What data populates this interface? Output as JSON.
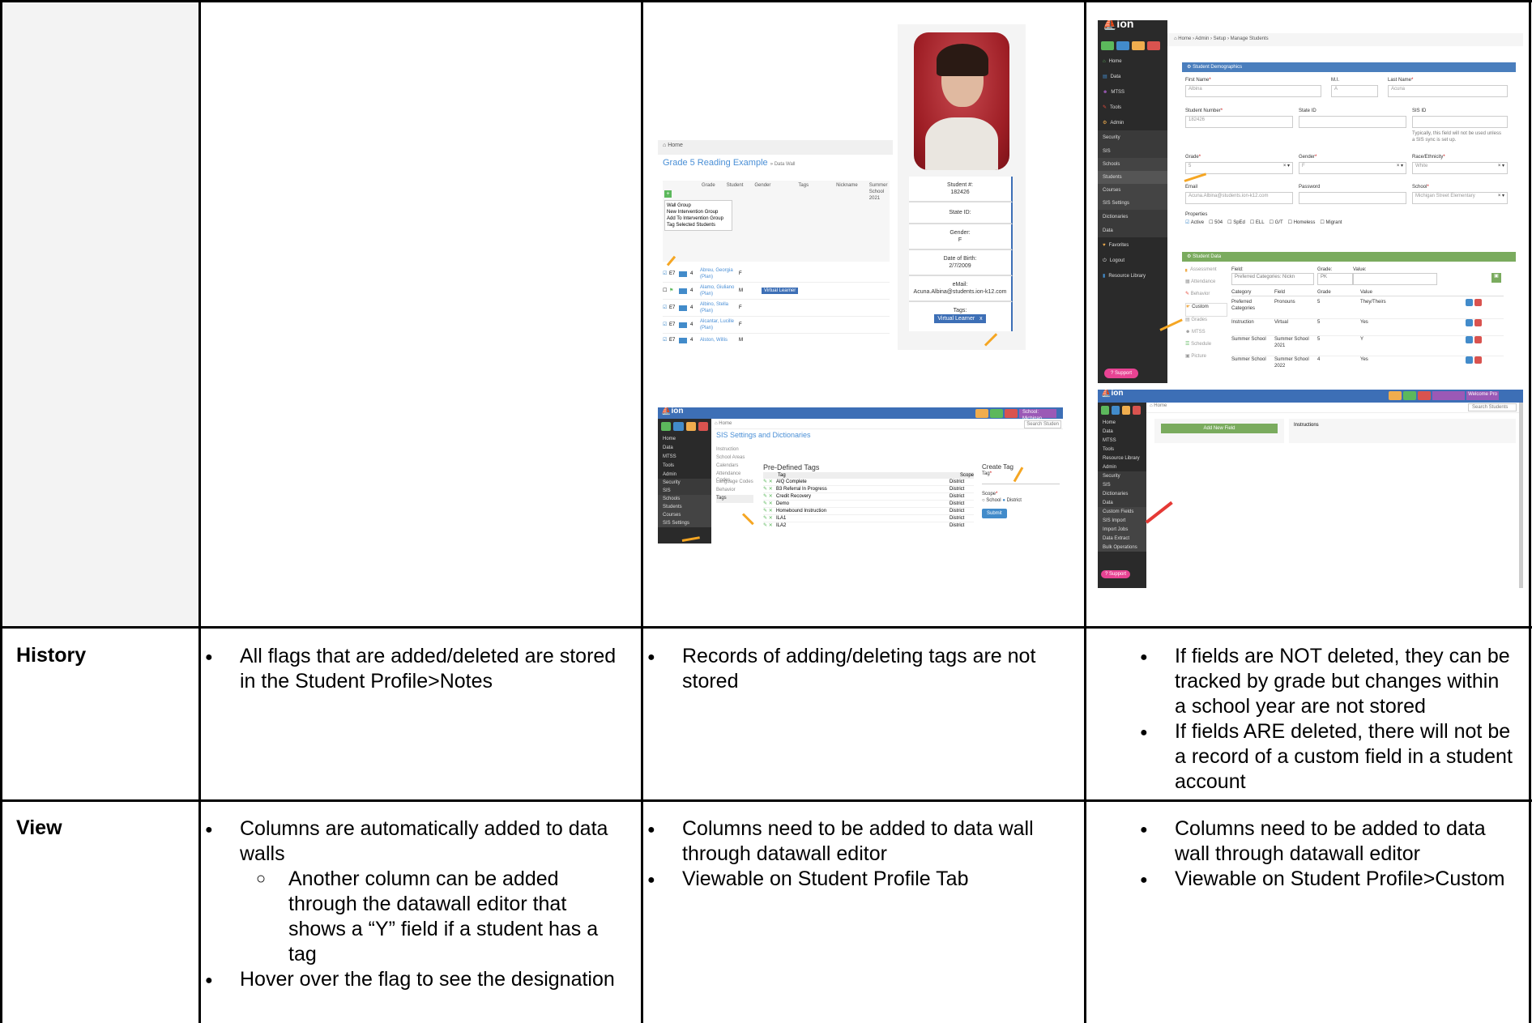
{
  "rows": {
    "history": {
      "label": "History",
      "col1": [
        "All flags that are added/deleted are stored in the Student Profile>Notes"
      ],
      "col2": [
        "Records of adding/deleting tags are not stored"
      ],
      "col3": [
        "If fields are NOT deleted, they can be tracked by grade but changes within a school year are not stored",
        "If fields ARE deleted, there will not be a record of a custom field in a student account"
      ]
    },
    "view": {
      "label": "View",
      "col1_a": "Columns are automatically added to data walls",
      "col1_sub": "Another column can be added through the datawall editor that shows a “Y” field if a student has a tag",
      "col1_b": "Hover over the flag to see the designation",
      "col2": [
        "Columns need to be added to data wall through datawall editor",
        "Viewable on Student Profile Tab"
      ],
      "col3": [
        "Columns need to be added to data wall through datawall editor",
        "Viewable on Student Profile>Custom"
      ]
    }
  },
  "shot_datawall": {
    "home": "Home",
    "title": "Grade 5 Reading Example",
    "crumb": "» Data Wall",
    "headers": [
      "Grade",
      "Student",
      "Gender",
      "Tags",
      "Nickname",
      "Summer School 2021",
      "Summ Scho 202"
    ],
    "menu": [
      "Wall Group",
      "New Intervention Group",
      "Add To Intervention Group",
      "Tag Selected Students"
    ],
    "students": [
      {
        "id": "E7",
        "grade": "4",
        "name": "Abreu, Georgia (Plan)",
        "gender": "F",
        "tag": ""
      },
      {
        "id": "",
        "grade": "4",
        "name": "Alamo, Giuliano (Plan)",
        "gender": "M",
        "tag": "Virtual Learner"
      },
      {
        "id": "E7",
        "grade": "4",
        "name": "Albino, Stella (Plan)",
        "gender": "F",
        "tag": ""
      },
      {
        "id": "E7",
        "grade": "4",
        "name": "Alcantar, Lucille (Plan)",
        "gender": "F",
        "tag": ""
      },
      {
        "id": "E7",
        "grade": "4",
        "name": "Alston, Willis",
        "gender": "M",
        "tag": ""
      }
    ]
  },
  "shot_profile": {
    "student_number_label": "Student #:",
    "student_number": "182426",
    "state_id_label": "State ID:",
    "gender_label": "Gender:",
    "gender": "F",
    "dob_label": "Date of Birth:",
    "dob": "2/7/2009",
    "email_label": "eMail:",
    "email": "Acuna.Albina@students.ion-k12.com",
    "tags_label": "Tags:",
    "tag": "Virtual Learner",
    "tag_x": "x"
  },
  "shot_sis": {
    "home": "Home",
    "title": "SIS Settings and Dictionaries",
    "search": "Search Studen",
    "school_user": "School: Michigan Street",
    "nav": [
      "Home",
      "Data",
      "MTSS",
      "Tools",
      "Admin",
      "Security",
      "SIS",
      "Schools",
      "Students",
      "Courses",
      "SIS Settings"
    ],
    "tabs": [
      "Instruction",
      "School Areas",
      "Calendars",
      "Attendance Codes",
      "Language Codes",
      "Behavior",
      "Tags"
    ],
    "table_title": "Pre-Defined Tags",
    "table_headers": [
      "Tag",
      "Scope"
    ],
    "tags": [
      {
        "name": "AIQ Complete",
        "scope": "District"
      },
      {
        "name": "B3 Referral In Progress",
        "scope": "District"
      },
      {
        "name": "Credit Recovery",
        "scope": "District"
      },
      {
        "name": "Demo",
        "scope": "District"
      },
      {
        "name": "Homebound Instruction",
        "scope": "District"
      },
      {
        "name": "ILA1",
        "scope": "District"
      },
      {
        "name": "ILA2",
        "scope": "District"
      }
    ],
    "create_title": "Create Tag",
    "tag_label": "Tag",
    "scope_label": "Scope",
    "scope_opts": [
      "School",
      "District"
    ],
    "submit": "Submit"
  },
  "shot_manage": {
    "breadcrumb": "Home › Admin › Setup › Manage Students",
    "nav": [
      "Home",
      "Data",
      "MTSS",
      "Tools",
      "Admin",
      "Security",
      "SIS",
      "Schools",
      "Students",
      "Courses",
      "SIS Settings",
      "Dictionaries",
      "Data",
      "Favorites",
      "Logout",
      "Resource Library"
    ],
    "support": "Support",
    "demo_title": "Student Demographics",
    "first_name_label": "First Name",
    "first_name": "Albina",
    "mi_label": "M.I.",
    "mi": "A",
    "last_name_label": "Last Name",
    "last_name": "Acuna",
    "student_number_label": "Student Number",
    "student_number": "182426",
    "state_id_label": "State ID",
    "sis_id_label": "SIS ID",
    "sis_note": "Typically, this field will not be used unless a SIS sync is set up.",
    "grade_label": "Grade",
    "grade": "5",
    "gender_label": "Gender",
    "gender": "F",
    "race_label": "Race/Ethnicity",
    "race": "White",
    "email_label": "Email",
    "email": "Acuna.Albina@students.ion-k12.com",
    "password_label": "Password",
    "school_label": "School",
    "school": "Michigan Street Elementary",
    "properties_label": "Properties",
    "properties": [
      "Active",
      "504",
      "SpEd",
      "ELL",
      "G/T",
      "Homeless",
      "Migrant"
    ],
    "data_title": "Student Data",
    "data_tabs": [
      "Assessment",
      "Attendance",
      "Behavior",
      "Custom",
      "Grades",
      "MTSS",
      "Schedule",
      "Picture"
    ],
    "field_label": "Field:",
    "field_value": "Preferred Categories: Nickn",
    "grade_f_label": "Grade:",
    "grade_f_value": "PK",
    "value_label": "Value:",
    "table_headers": [
      "Category",
      "Field",
      "Grade",
      "Value"
    ],
    "rows": [
      {
        "category": "Preferred Categories",
        "field": "Pronouns",
        "grade": "5",
        "value": "They/Theirs"
      },
      {
        "category": "Instruction",
        "field": "Virtual",
        "grade": "5",
        "value": "Yes"
      },
      {
        "category": "Summer School",
        "field": "Summer School 2021",
        "grade": "5",
        "value": "Y"
      },
      {
        "category": "Summer School",
        "field": "Summer School 2022",
        "grade": "4",
        "value": "Yes"
      }
    ]
  },
  "shot_custom": {
    "home": "Home",
    "search": "Search Students",
    "add_button": "Add New Field",
    "instructions": "Instructions",
    "nav": [
      "Home",
      "Data",
      "MTSS",
      "Tools",
      "Resource Library",
      "Admin",
      "Security",
      "SIS",
      "Dictionaries",
      "Data",
      "Custom Fields",
      "SIS Import",
      "Import Jobs",
      "Data Extract",
      "Bulk Operations"
    ],
    "support": "Support",
    "user": "Welcome Pro"
  },
  "colors": {
    "sidebar": "#2a2a2a",
    "header": "#3d6fb6",
    "blue": "#4a7ebd",
    "green": "#7aab5e",
    "arrow": "#f5a623",
    "red_arrow": "#e53935"
  }
}
